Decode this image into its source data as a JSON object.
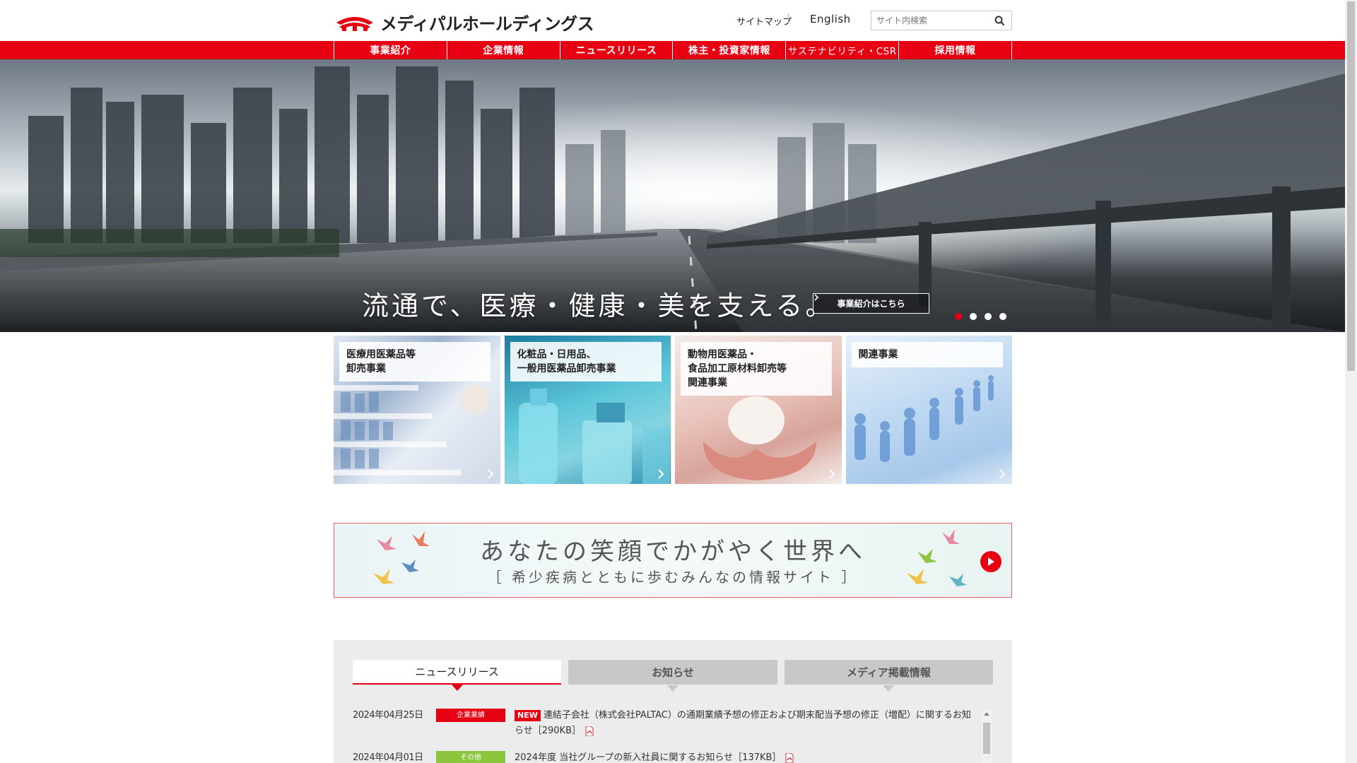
{
  "header": {
    "logo_text": "メディパルホールディングス",
    "sitemap_label": "サイトマップ",
    "english_label": "English",
    "search_placeholder": "サイト内検索"
  },
  "nav": {
    "items": [
      "事業紹介",
      "企業情報",
      "ニュースリリース",
      "株主・投資家情報",
      "サステナビリティ・CSR",
      "採用情報"
    ]
  },
  "hero": {
    "caption": "流通で、医療・健康・美を支える。",
    "button_label": "事業紹介はこちら",
    "slides_count": 4,
    "active_slide": 1
  },
  "cards": [
    {
      "label": "医療用医薬品等\n卸売事業"
    },
    {
      "label": "化粧品・日用品、\n一般用医薬品卸売事業"
    },
    {
      "label": "動物用医薬品・\n食品加工原材料卸売等\n関連事業"
    },
    {
      "label": "関連事業"
    }
  ],
  "banner": {
    "title": "あなたの笑顔でかがやく世界へ",
    "subtitle": "［ 希少疾病とともに歩むみんなの情報サイト ］"
  },
  "news": {
    "tabs": [
      "ニュースリリース",
      "お知らせ",
      "メディア掲載情報"
    ],
    "active_tab": 0,
    "items": [
      {
        "date": "2024年04月25日",
        "category": "企業業績",
        "is_new": true,
        "new_label": "NEW",
        "text": "連結子会社（株式会社PALTAC）の通期業績予想の修正および期末配当予想の修正（増配）に関するお知らせ［290KB］"
      },
      {
        "date": "2024年04月01日",
        "category": "その他",
        "is_new": false,
        "text": "2024年度 当社グループの新入社員に関するお知らせ［137KB］"
      }
    ]
  },
  "colors": {
    "brand_red": "#e60012",
    "category_green": "#8cc63f"
  }
}
